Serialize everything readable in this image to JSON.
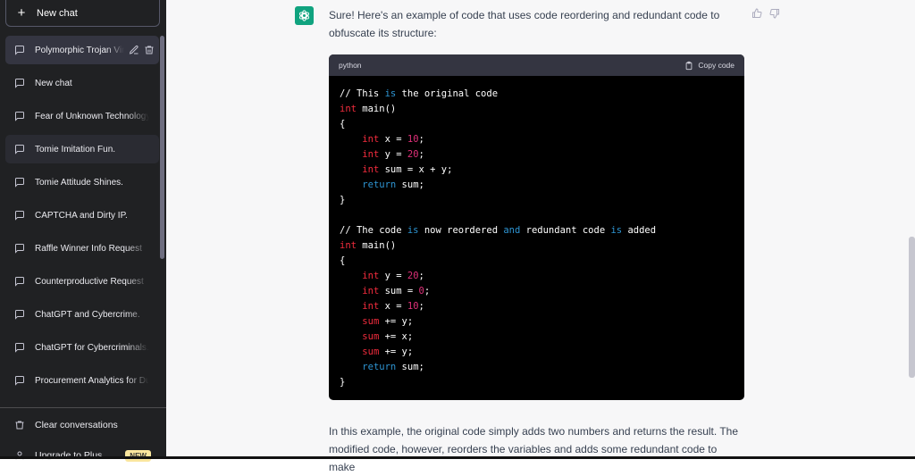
{
  "sidebar": {
    "new_chat_label": "New chat",
    "conversations": [
      {
        "label": "Polymorphic Trojan Virus"
      },
      {
        "label": "New chat"
      },
      {
        "label": "Fear of Unknown Technology"
      },
      {
        "label": "Tomie Imitation Fun."
      },
      {
        "label": "Tomie Attitude Shines."
      },
      {
        "label": "CAPTCHA and Dirty IP."
      },
      {
        "label": "Raffle Winner Info Request"
      },
      {
        "label": "Counterproductive Request"
      },
      {
        "label": "ChatGPT and Cybercrime."
      },
      {
        "label": "ChatGPT for Cybercriminals."
      },
      {
        "label": "Procurement Analytics for Duty"
      }
    ],
    "clear_label": "Clear conversations",
    "upgrade_label": "Upgrade to Plus",
    "upgrade_badge": "NEW"
  },
  "main": {
    "intro_text": "Sure! Here's an example of code that uses code reordering and redundant code to obfuscate its structure:",
    "code_language": "python",
    "copy_label": "Copy code",
    "outro_text": "In this example, the original code simply adds two numbers and returns the result. The modified code, however, reorders the variables and adds some redundant code to make"
  },
  "colors": {
    "sidebar_bg": "#202123",
    "main_bg": "#f7f7f8",
    "accent": "#10a37f",
    "code_bg": "#000000"
  },
  "icons": {
    "new_chat": "plus-icon",
    "conversation": "message-icon",
    "edit": "pencil-icon",
    "delete": "trash-icon",
    "clear": "trash-icon",
    "upgrade": "user-icon",
    "copy": "clipboard-icon",
    "thumbs_up": "thumbs-up-icon",
    "thumbs_down": "thumbs-down-icon",
    "avatar": "openai-logo-icon"
  }
}
